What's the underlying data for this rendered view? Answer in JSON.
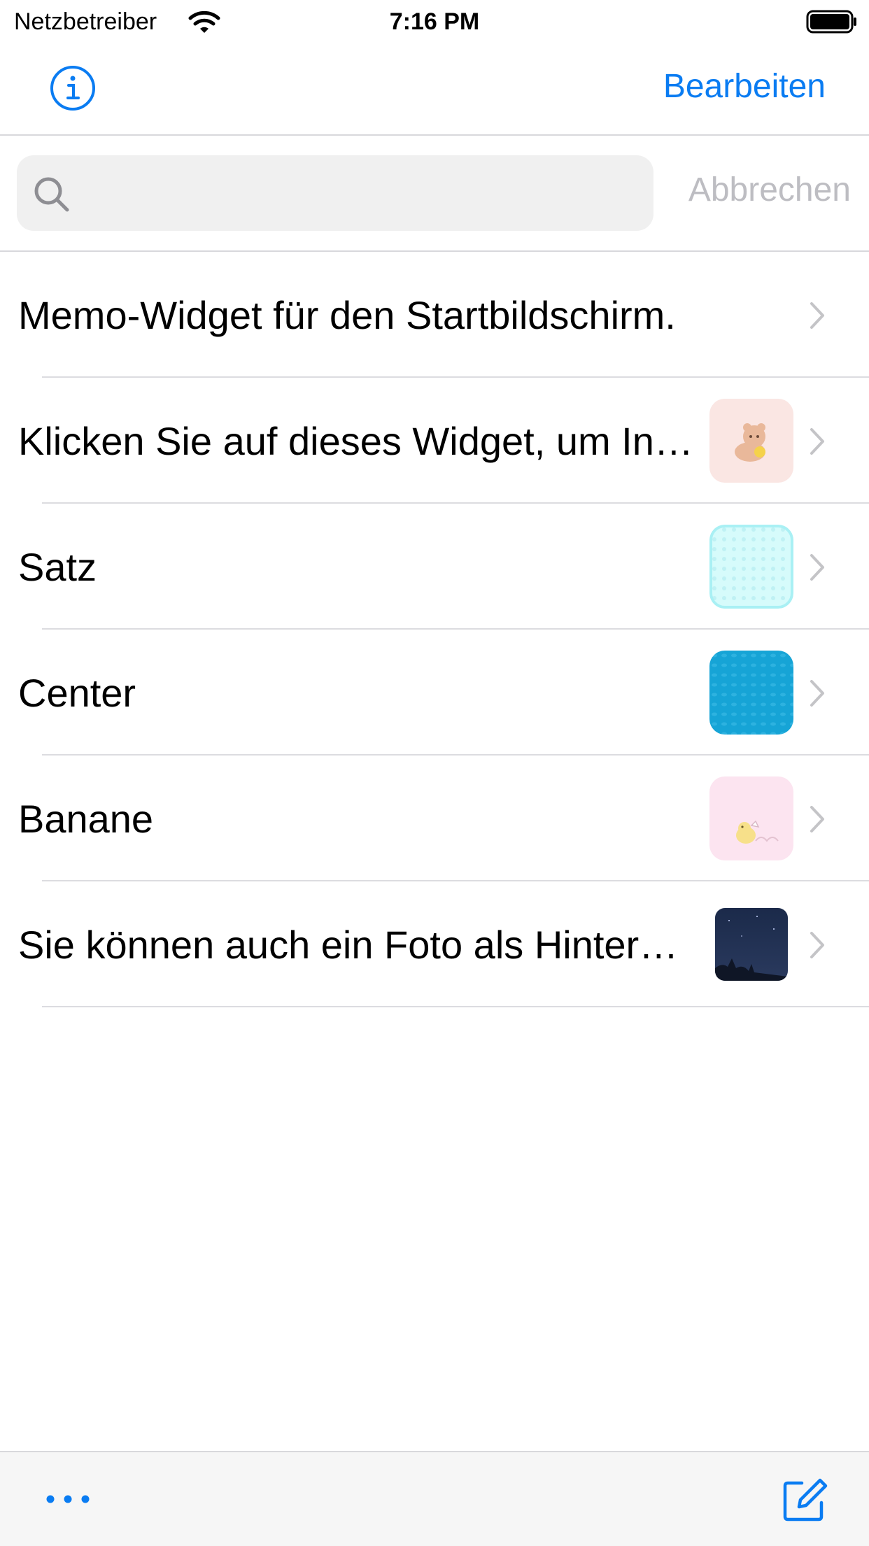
{
  "status_bar": {
    "carrier": "Netzbetreiber",
    "time": "7:16 PM",
    "wifi_icon": "wifi-icon",
    "battery_icon": "battery-full-icon"
  },
  "nav_bar": {
    "info_icon": "info-circle-icon",
    "edit_label": "Bearbeiten"
  },
  "search": {
    "icon": "magnifier-icon",
    "value": "",
    "placeholder": "",
    "cancel_label": "Abbrechen"
  },
  "list": {
    "items": [
      {
        "title": "Memo-Widget für den Startbildschirm.",
        "thumbnail": null
      },
      {
        "title": "Klicken Sie auf dieses Widget, um In…",
        "thumbnail": "bear-on-pink"
      },
      {
        "title": "Satz",
        "thumbnail": "light-cyan-dots"
      },
      {
        "title": "Center",
        "thumbnail": "blue-dots"
      },
      {
        "title": "Banane",
        "thumbnail": "chick-on-pink"
      },
      {
        "title": "Sie können auch ein Foto als Hintergr…",
        "thumbnail": "night-sky-photo"
      }
    ]
  },
  "toolbar": {
    "more_icon": "ellipsis-icon",
    "compose_icon": "compose-icon"
  },
  "colors": {
    "accent": "#0a7cf2",
    "separator": "#dcdce0",
    "search_bg": "#f0f0f0",
    "cancel_text": "#bdbdc2",
    "toolbar_bg": "#f6f6f6"
  }
}
